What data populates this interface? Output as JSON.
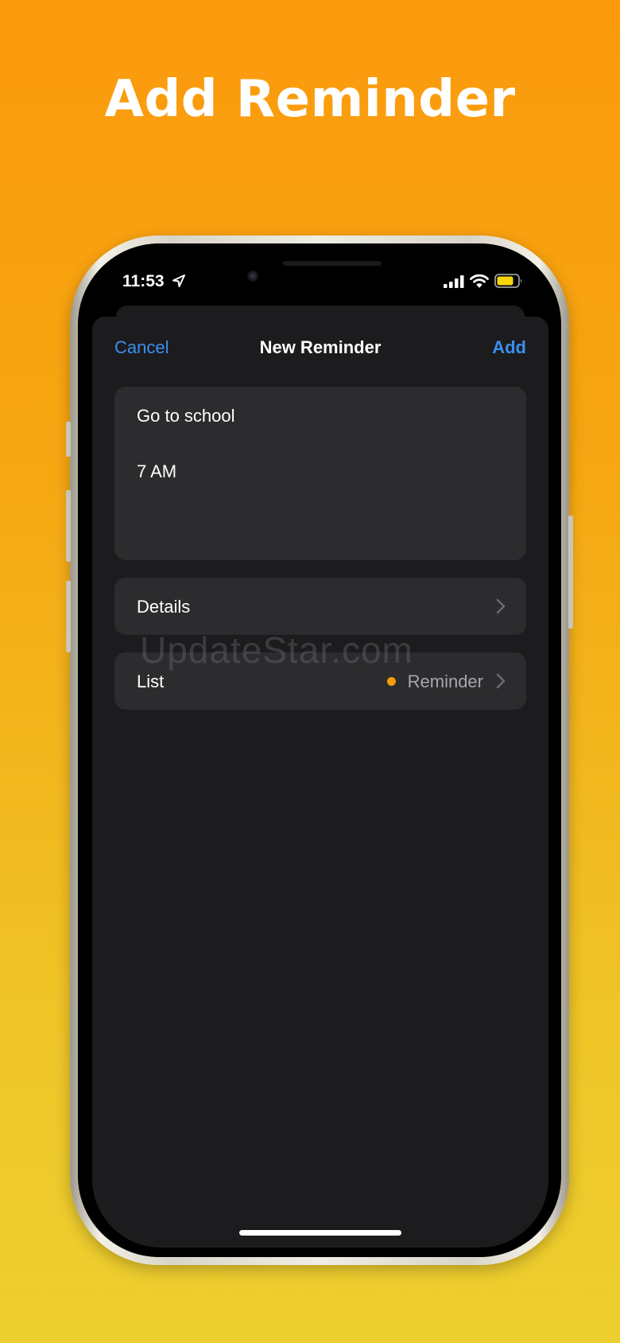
{
  "headline": "Add Reminder",
  "status_bar": {
    "time": "11:53",
    "icons": [
      "location-arrow-icon",
      "cellular-signal-icon",
      "wifi-icon",
      "battery-icon"
    ]
  },
  "nav": {
    "cancel_label": "Cancel",
    "title": "New Reminder",
    "add_label": "Add"
  },
  "reminder": {
    "title": "Go to school",
    "notes": "7 AM"
  },
  "rows": {
    "details_label": "Details",
    "list_label": "List",
    "list_value": "Reminder",
    "list_color": "#f59a0a"
  },
  "watermark": "UpdateStar.com",
  "colors": {
    "accent": "#3b8ff0",
    "sheet_background": "#1c1c1e",
    "card_background": "#2c2c2e",
    "background_top": "#fb9a0c",
    "background_bottom": "#edcf2f",
    "battery_fill": "#f5d60a"
  }
}
